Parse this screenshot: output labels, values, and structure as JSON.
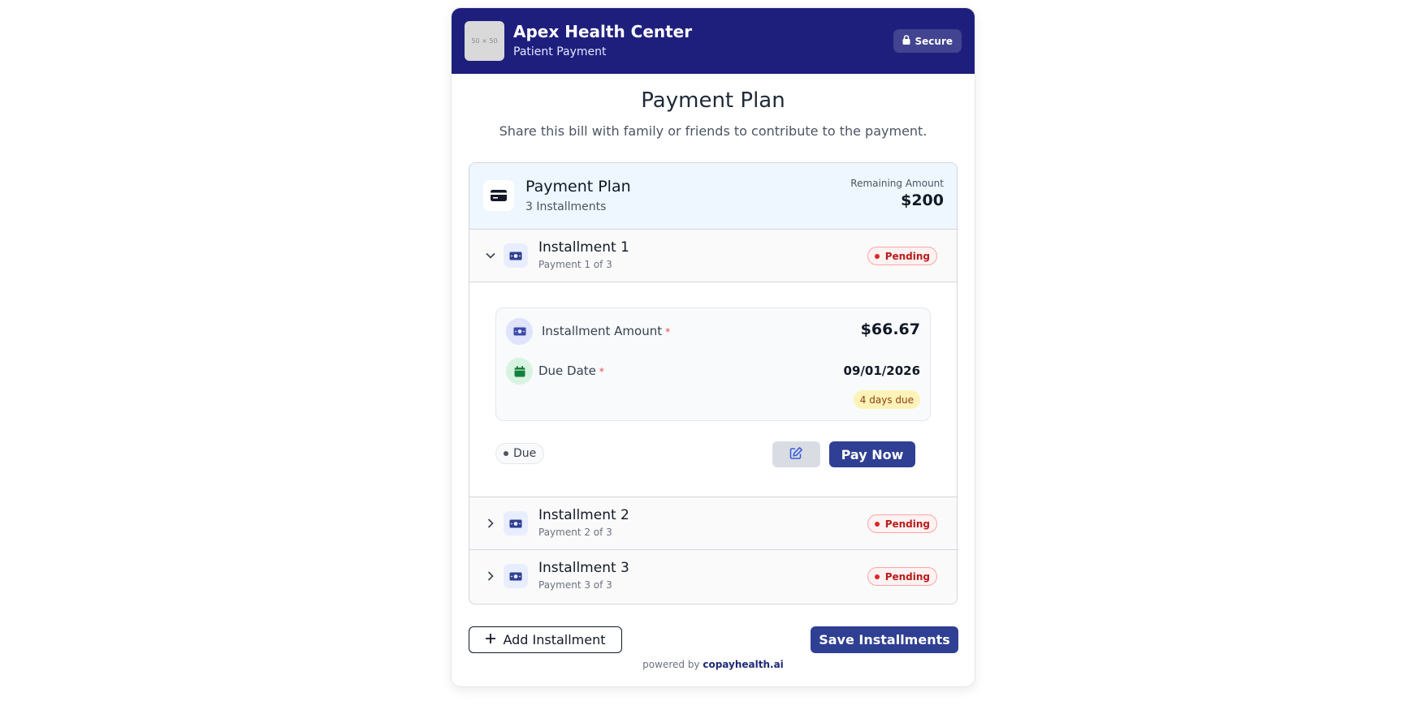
{
  "header": {
    "logo_placeholder": "50 × 50",
    "org_name": "Apex Health Center",
    "org_subtitle": "Patient Payment",
    "secure_label": "Secure"
  },
  "page": {
    "title": "Payment Plan",
    "subtitle": "Share this bill with family or friends to contribute to the payment."
  },
  "plan": {
    "title": "Payment Plan",
    "installments_count_label": "3 Installments",
    "remaining_label": "Remaining Amount",
    "remaining_amount": "$200"
  },
  "installments": [
    {
      "name": "Installment 1",
      "sub": "Payment 1 of 3",
      "status": "Pending",
      "expanded": true
    },
    {
      "name": "Installment 2",
      "sub": "Payment 2 of 3",
      "status": "Pending",
      "expanded": false
    },
    {
      "name": "Installment 3",
      "sub": "Payment 3 of 3",
      "status": "Pending",
      "expanded": false
    }
  ],
  "detail": {
    "amount_label": "Installment Amount",
    "amount_required": "*",
    "amount_value": "$66.67",
    "due_date_label": "Due Date",
    "due_date_required": "*",
    "due_date_value": "09/01/2026",
    "days_due": "4 days due",
    "due_status": "Due",
    "pay_now_label": "Pay Now"
  },
  "footer": {
    "add_installment_label": "Add Installment",
    "save_installments_label": "Save Installments",
    "powered_by": "powered by",
    "brand": "copayhealth.ai"
  },
  "colors": {
    "header_bg": "#1e1f7d",
    "primary_button": "#2f3f93",
    "pending_red": "#dc2626",
    "plan_header_bg": "#eef6ff"
  }
}
